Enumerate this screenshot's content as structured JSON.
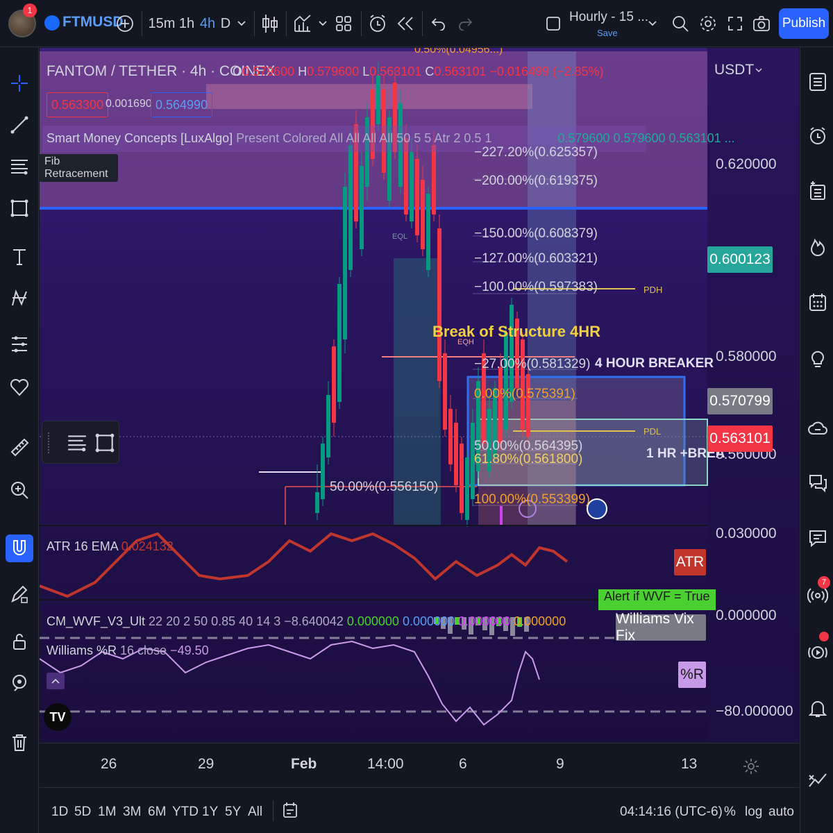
{
  "header": {
    "notification_count": "1",
    "symbol": "FTMUSD",
    "intervals": [
      "15m",
      "1h",
      "4h",
      "D"
    ],
    "active_interval": "4h",
    "layout_name": "Hourly - 15 ...",
    "layout_save": "Save",
    "publish_label": "Publish"
  },
  "legend": {
    "title": "FANTOM / TETHER · 4h · COINEX",
    "o_label": "O",
    "o_value": "0.579600",
    "h_label": "H",
    "h_value": "0.579600",
    "l_label": "L",
    "l_value": "0.563101",
    "c_label": "C",
    "c_value": "0.563101",
    "change": "−0.016499 (−2.85%)",
    "bid": "0.563300",
    "spread": "0.001690",
    "ask": "0.564990",
    "indicator_name": "Smart Money Concepts [LuxAlgo]",
    "indicator_params": "Present Colored All All All All 50 5 5 Atr 2 0.5 1",
    "indicator_values": "0.579600  0.579600  0.563101  ..."
  },
  "tooltip": "Fib Retracement",
  "price_axis": {
    "currency": "USDT",
    "labels": [
      "0.620000",
      "0.580000",
      "0.560000"
    ],
    "tag_green": "0.600123",
    "tag_gray": "0.570799",
    "tag_red": "0.563101",
    "atr_axis": "0.030000",
    "wvf_axis": "0.000000",
    "wr_axis": "−80.000000"
  },
  "fib_levels": [
    "−227.20%(0.625357)",
    "−200.00%(0.619375)",
    "−150.00%(0.608379)",
    "−127.00%(0.603321)",
    "−100.00%(0.597383)",
    "−27.00%(0.581329)",
    "0.00%(0.575391)",
    "50.00%(0.564395)",
    "61.80%(0.561800)",
    "100.00%(0.553399)"
  ],
  "fib_top_partial": "0.50%(0.04956...)",
  "annotations": {
    "bos": "Break of Structure 4HR",
    "breaker_4h": "4 HOUR BREAKER",
    "breaker_1h": "1 HR +BREA",
    "pdh": "PDH",
    "pdl": "PDL",
    "eql": "EQL",
    "eqh": "EQH",
    "fifty": "50.00%(0.556150)",
    "alert": "Alert if WVF = True"
  },
  "atr": {
    "name": "ATR 16 EMA",
    "value": "0.024132",
    "tag": "ATR"
  },
  "wvf": {
    "name": "CM_WVF_V3_Ult",
    "params": "22 20 2 50 0.85 40 14 3",
    "v1": "−8.640042",
    "v2": "0.000000",
    "v3": "0.000000",
    "v4": "0.000000",
    "v5": "0.000000",
    "tag": "Williams Vix Fix"
  },
  "wr": {
    "name": "Williams %R",
    "params": "16 close",
    "value": "−49.50",
    "tag": "%R"
  },
  "time_axis": [
    "26",
    "29",
    "Feb",
    "14:00",
    "6",
    "9",
    "13"
  ],
  "range_buttons": [
    "1D",
    "5D",
    "1M",
    "3M",
    "6M",
    "YTD",
    "1Y",
    "5Y",
    "All"
  ],
  "clock": "04:14:16 (UTC-6)",
  "scale_opts": [
    "%",
    "log",
    "auto"
  ],
  "right_badge": "7",
  "colors": {
    "up": "#089981",
    "down": "#f23645",
    "accent": "#2962ff",
    "fib": "#d1d4dc",
    "atr_line": "#c0362c",
    "wr_line": "#c89ae8"
  }
}
